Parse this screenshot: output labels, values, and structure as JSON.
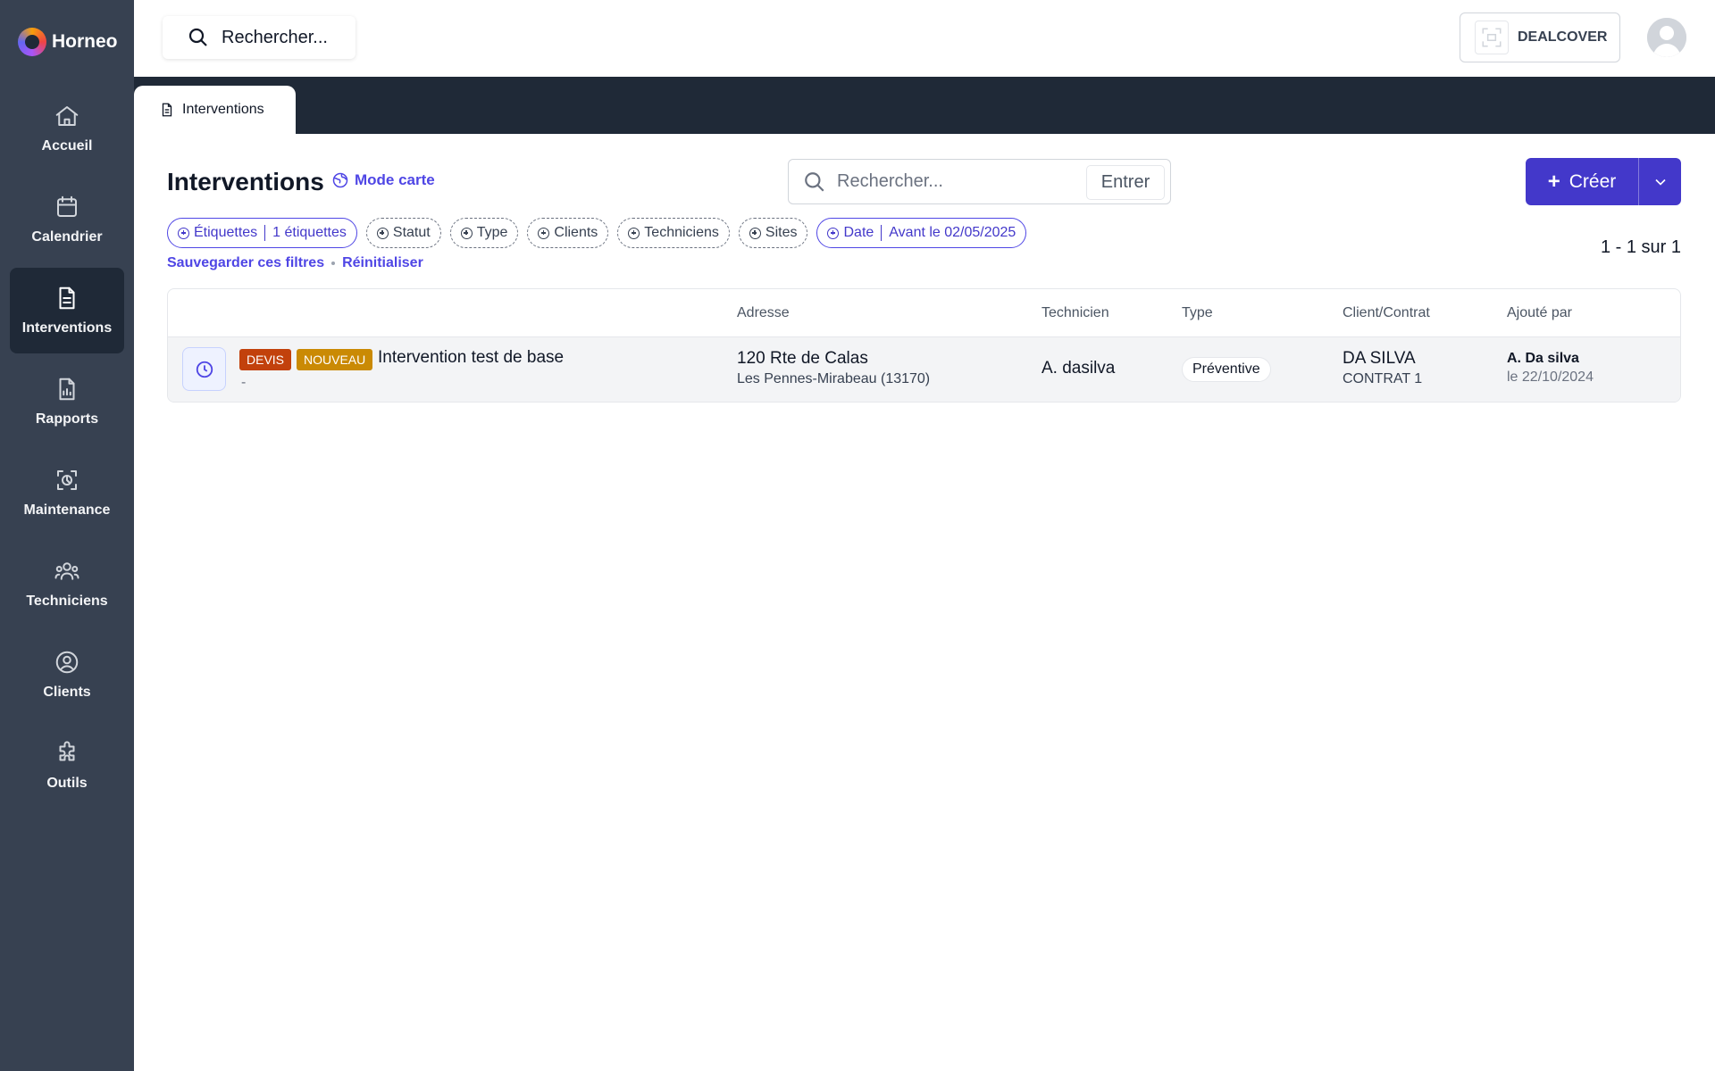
{
  "brand": {
    "name": "Horneo"
  },
  "sidebar": {
    "items": [
      {
        "label": "Accueil",
        "icon": "home-icon",
        "active": false
      },
      {
        "label": "Calendrier",
        "icon": "calendar-icon",
        "active": false
      },
      {
        "label": "Interventions",
        "icon": "document-icon",
        "active": true
      },
      {
        "label": "Rapports",
        "icon": "report-icon",
        "active": false
      },
      {
        "label": "Maintenance",
        "icon": "maintenance-icon",
        "active": false
      },
      {
        "label": "Techniciens",
        "icon": "users-icon",
        "active": false
      },
      {
        "label": "Clients",
        "icon": "user-circle-icon",
        "active": false
      },
      {
        "label": "Outils",
        "icon": "puzzle-icon",
        "active": false
      }
    ]
  },
  "topbar": {
    "search_placeholder": "Rechercher...",
    "company_name": "DEALCOVER"
  },
  "tabs": [
    {
      "label": "Interventions",
      "icon": "document-icon",
      "active": true
    }
  ],
  "page": {
    "title": "Interventions",
    "map_mode_label": "Mode carte",
    "search_placeholder": "Rechercher...",
    "enter_label": "Entrer",
    "create_label": "Créer",
    "pagination": "1 - 1 sur 1",
    "save_filters_label": "Sauvegarder ces filtres",
    "reset_label": "Réinitialiser"
  },
  "filters": [
    {
      "label": "Étiquettes",
      "value": "1 étiquettes",
      "applied": true
    },
    {
      "label": "Statut",
      "value": "",
      "applied": false
    },
    {
      "label": "Type",
      "value": "",
      "applied": false
    },
    {
      "label": "Clients",
      "value": "",
      "applied": false
    },
    {
      "label": "Techniciens",
      "value": "",
      "applied": false
    },
    {
      "label": "Sites",
      "value": "",
      "applied": false
    },
    {
      "label": "Date",
      "value": "Avant le 02/05/2025",
      "applied": true
    }
  ],
  "table": {
    "columns": {
      "address": "Adresse",
      "technician": "Technicien",
      "type": "Type",
      "client": "Client/Contrat",
      "added_by": "Ajouté par"
    },
    "rows": [
      {
        "status_icon": "clock-icon",
        "badges": [
          {
            "label": "DEVIS",
            "color": "#c2410c"
          },
          {
            "label": "NOUVEAU",
            "color": "#ca8a04"
          }
        ],
        "title": "Intervention test de base",
        "subtitle": "-",
        "address_line1": "120 Rte de Calas",
        "address_line2": "Les Pennes-Mirabeau (13170)",
        "technician": "A. dasilva",
        "type": "Préventive",
        "client": "DA SILVA",
        "contract": "CONTRAT 1",
        "added_by": "A. Da silva",
        "added_on": "le 22/10/2024"
      }
    ]
  },
  "colors": {
    "sidebar_bg": "#374151",
    "accent": "#4338ca",
    "badge_devis": "#c2410c",
    "badge_nouveau": "#ca8a04"
  }
}
